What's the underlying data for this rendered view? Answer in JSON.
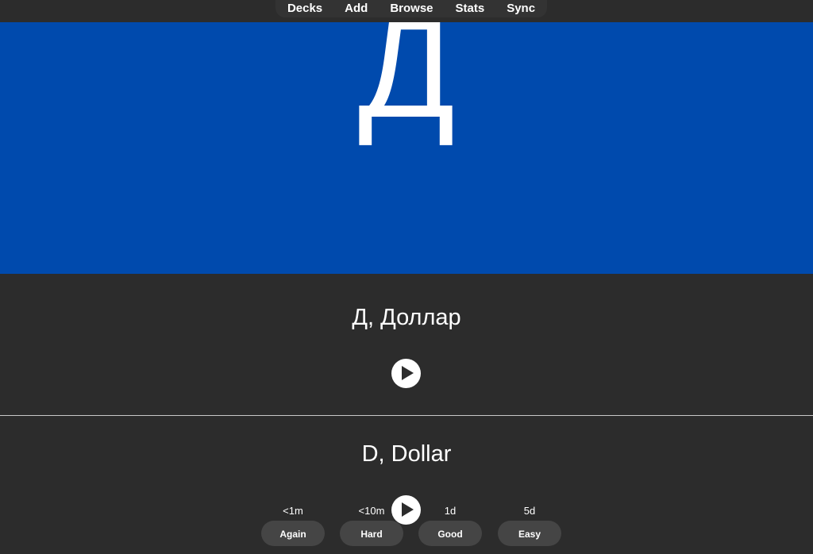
{
  "menu": {
    "items": [
      "Decks",
      "Add",
      "Browse",
      "Stats",
      "Sync"
    ]
  },
  "card": {
    "image_letter": "Д",
    "image_bg_color": "#004aad",
    "front_text": "Д, Доллар",
    "back_text": "D, Dollar"
  },
  "answer_buttons": [
    {
      "interval": "<1m",
      "label": "Again"
    },
    {
      "interval": "<10m",
      "label": "Hard"
    },
    {
      "interval": "1d",
      "label": "Good"
    },
    {
      "interval": "5d",
      "label": "Easy"
    }
  ],
  "colors": {
    "background": "#2c2c2c",
    "button": "#454545",
    "text": "#ffffff"
  },
  "icons": [
    "play-icon"
  ]
}
